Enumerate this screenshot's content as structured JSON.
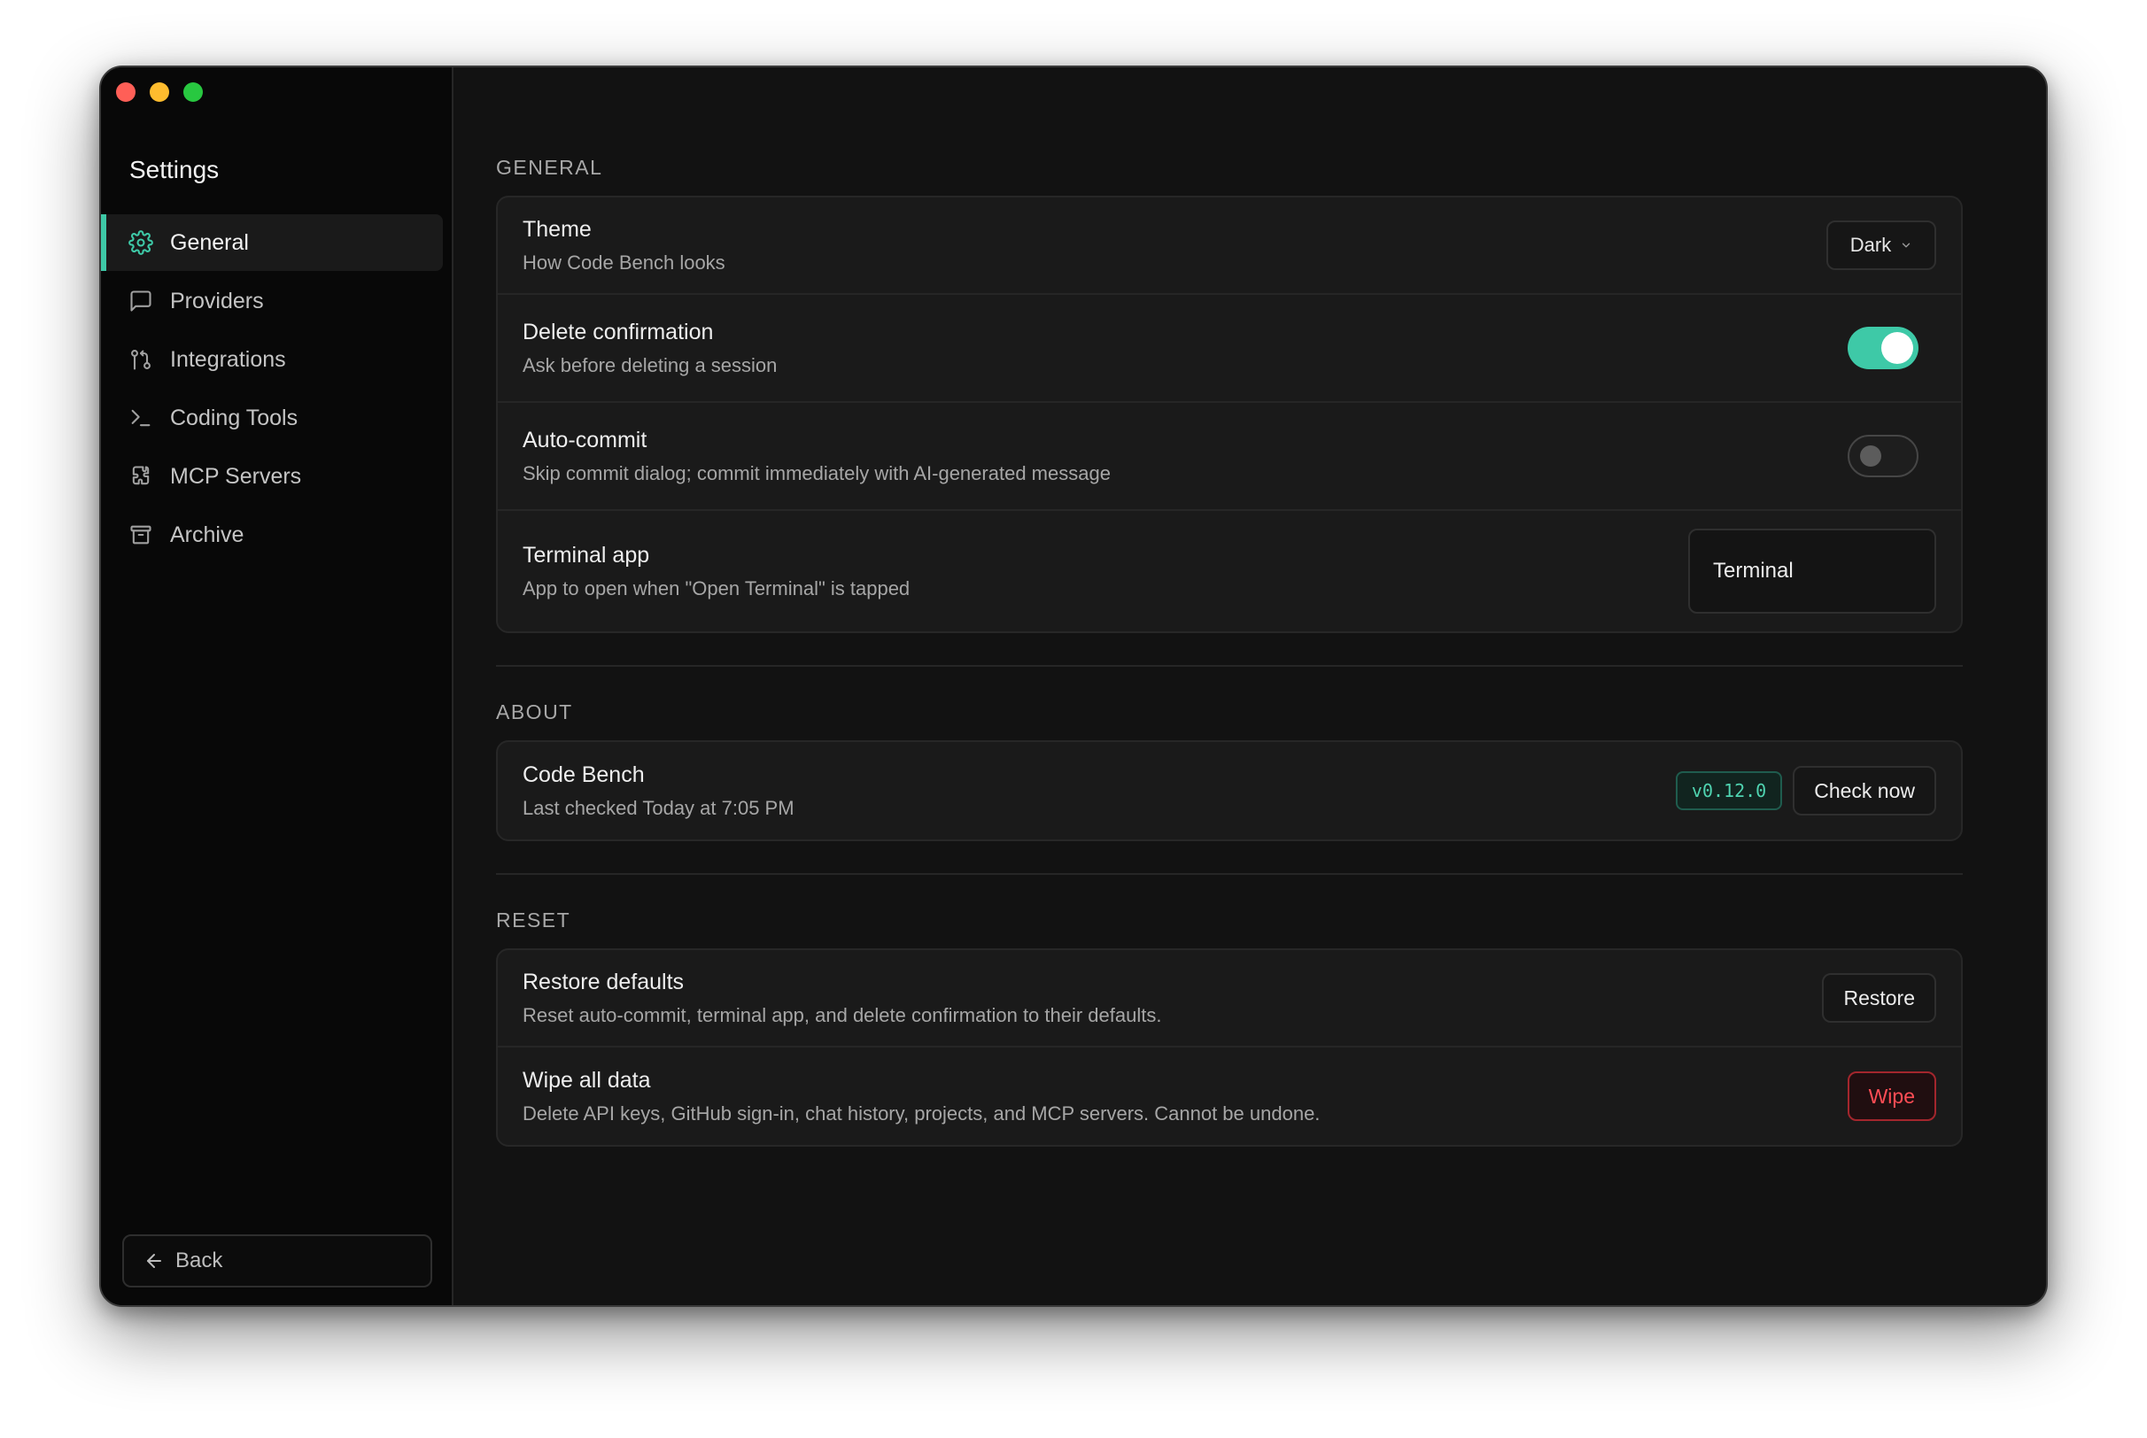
{
  "sidebar": {
    "title": "Settings",
    "items": [
      {
        "label": "General",
        "icon": "gear-icon",
        "active": true
      },
      {
        "label": "Providers",
        "icon": "chat-icon"
      },
      {
        "label": "Integrations",
        "icon": "git-pull-request-icon"
      },
      {
        "label": "Coding Tools",
        "icon": "terminal-icon"
      },
      {
        "label": "MCP Servers",
        "icon": "puzzle-icon"
      },
      {
        "label": "Archive",
        "icon": "archive-icon"
      }
    ],
    "back_label": "Back"
  },
  "general": {
    "section": "GENERAL",
    "theme": {
      "title": "Theme",
      "desc": "How Code Bench looks",
      "value": "Dark"
    },
    "delete_confirmation": {
      "title": "Delete confirmation",
      "desc": "Ask before deleting a session",
      "enabled": true
    },
    "auto_commit": {
      "title": "Auto-commit",
      "desc": "Skip commit dialog; commit immediately with AI-generated message",
      "enabled": false
    },
    "terminal_app": {
      "title": "Terminal app",
      "desc": "App to open when \"Open Terminal\" is tapped",
      "value": "Terminal"
    }
  },
  "about": {
    "section": "ABOUT",
    "title": "Code Bench",
    "desc": "Last checked Today at 7:05 PM",
    "version": "v0.12.0",
    "check_label": "Check now"
  },
  "reset": {
    "section": "RESET",
    "restore": {
      "title": "Restore defaults",
      "desc": "Reset auto-commit, terminal app, and delete confirmation to their defaults.",
      "button": "Restore"
    },
    "wipe": {
      "title": "Wipe all data",
      "desc": "Delete API keys, GitHub sign-in, chat history, projects, and MCP servers. Cannot be undone.",
      "button": "Wipe"
    }
  },
  "colors": {
    "accent": "#3ec9a7",
    "danger": "#ff4d55",
    "background": "#121212",
    "sidebar": "#080808"
  }
}
